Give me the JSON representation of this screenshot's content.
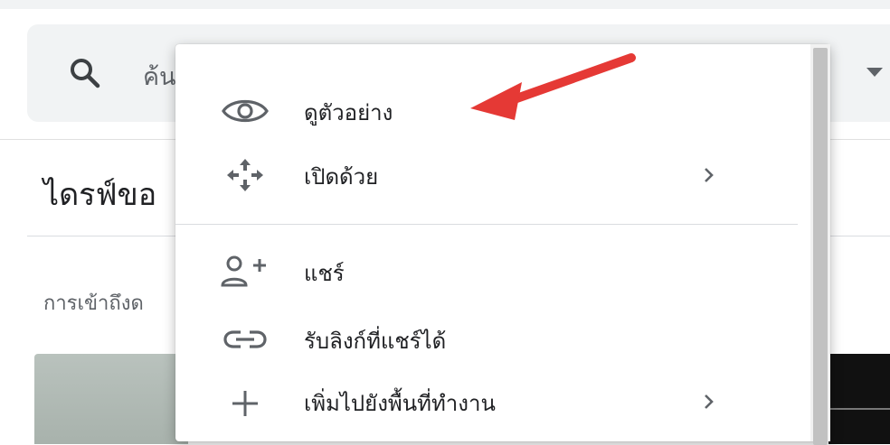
{
  "search": {
    "placeholder_visible": "ค้น",
    "icon": "search-icon",
    "dropdown_icon": "dropdown-arrow-icon"
  },
  "page": {
    "title_visible": "ไดรฟ์ขอ",
    "section_label_visible": "การเข้าถึงด"
  },
  "context_menu": {
    "items": [
      {
        "label": "ดูตัวอย่าง",
        "icon": "eye-icon",
        "has_submenu": false
      },
      {
        "label": "เปิดด้วย",
        "icon": "open-with-move-icon",
        "has_submenu": true
      },
      {
        "label": "แชร์",
        "icon": "person-add-icon",
        "has_submenu": false
      },
      {
        "label": "รับลิงก์ที่แชร์ได้",
        "icon": "link-icon",
        "has_submenu": false
      },
      {
        "label": "เพิ่มไปยังพื้นที่ทำงาน",
        "icon": "plus-icon",
        "has_submenu": true
      }
    ]
  },
  "annotation": {
    "arrow_color": "#e53935",
    "points_to": "ดูตัวอย่าง"
  }
}
